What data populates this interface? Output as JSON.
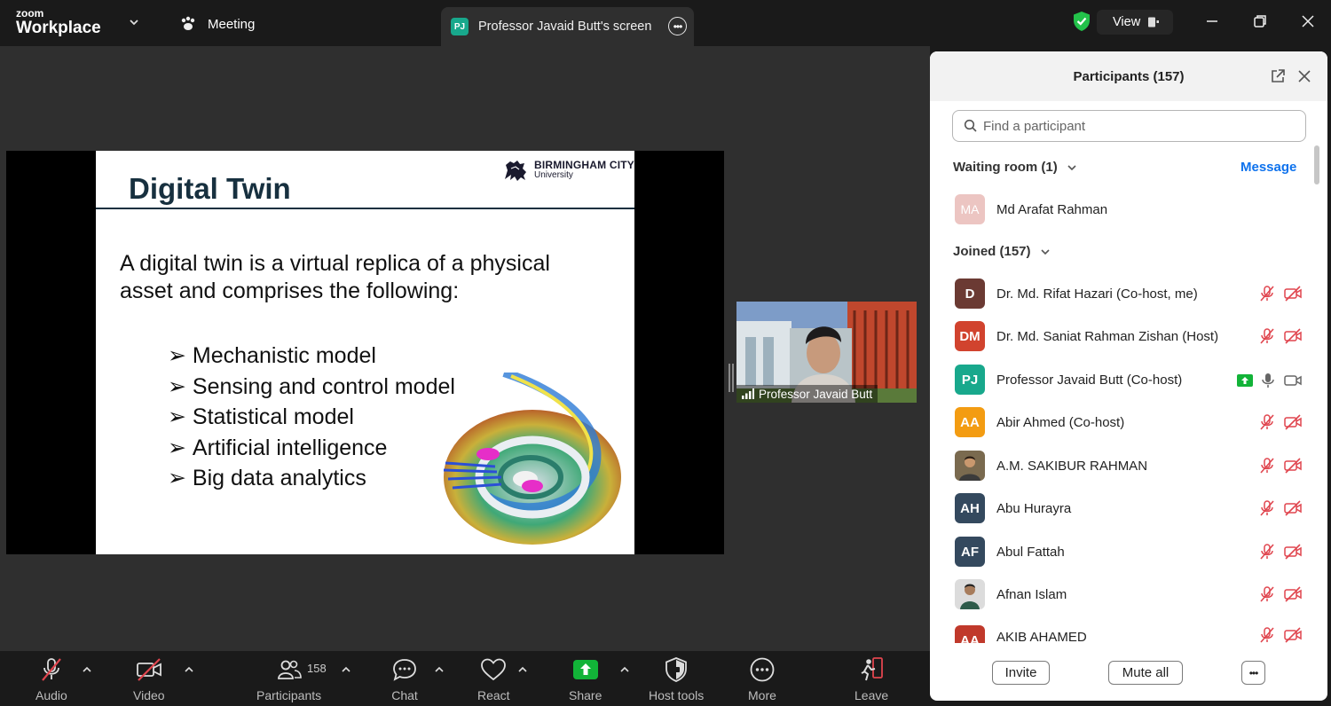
{
  "app": {
    "logo_top": "zoom",
    "logo_bottom": "Workplace"
  },
  "topbar": {
    "meeting_label": "Meeting",
    "screen_tab": {
      "initials": "PJ",
      "label": "Professor Javaid Butt's screen"
    },
    "view_label": "View"
  },
  "slide": {
    "title": "Digital Twin",
    "logo_line1": "BIRMINGHAM CITY",
    "logo_line2": "University",
    "intro": "A digital twin is a virtual replica of a physical asset and comprises the following:",
    "bullets": [
      "Mechanistic model",
      "Sensing and control model",
      "Statistical model",
      "Artificial intelligence",
      "Big data analytics"
    ]
  },
  "video_tile": {
    "name": "Professor Javaid Butt"
  },
  "participants_panel": {
    "title": "Participants (157)",
    "search_placeholder": "Find a participant",
    "waiting_room": {
      "label": "Waiting room (1)",
      "message_label": "Message"
    },
    "waiting": [
      {
        "initials": "MA",
        "name": "Md Arafat Rahman",
        "color": "#e9c8c8"
      }
    ],
    "joined_label": "Joined (157)",
    "joined": [
      {
        "initials": "D",
        "name": "Dr. Md. Rifat Hazari (Co-host, me)",
        "color": "#6b3a33",
        "muted": true,
        "video_off": true,
        "sharing": false
      },
      {
        "initials": "DM",
        "name": "Dr. Md. Saniat Rahman Zishan (Host)",
        "color": "#d1432e",
        "muted": true,
        "video_off": true,
        "sharing": false
      },
      {
        "initials": "PJ",
        "name": "Professor Javaid Butt (Co-host)",
        "color": "#18a88c",
        "muted": false,
        "video_off": false,
        "sharing": true
      },
      {
        "initials": "AA",
        "name": "Abir Ahmed (Co-host)",
        "color": "#f39c12",
        "muted": true,
        "video_off": true,
        "sharing": false
      },
      {
        "initials": "",
        "name": "A.M. SAKIBUR RAHMAN",
        "color": "#5c4a3a",
        "muted": true,
        "video_off": true,
        "sharing": false,
        "photo": true
      },
      {
        "initials": "AH",
        "name": "Abu Hurayra",
        "color": "#34495e",
        "muted": true,
        "video_off": true,
        "sharing": false
      },
      {
        "initials": "AF",
        "name": "Abul Fattah",
        "color": "#34495e",
        "muted": true,
        "video_off": true,
        "sharing": false
      },
      {
        "initials": "",
        "name": "Afnan Islam",
        "color": "#8b8f93",
        "muted": true,
        "video_off": true,
        "sharing": false,
        "photo": true
      },
      {
        "initials": "AA",
        "name": "AKIB AHAMED",
        "color": "#c0392b",
        "muted": true,
        "video_off": true,
        "sharing": false
      }
    ],
    "footer": {
      "invite": "Invite",
      "mute_all": "Mute all"
    }
  },
  "toolbar": {
    "audio": "Audio",
    "video": "Video",
    "participants": "Participants",
    "participants_count": "158",
    "chat": "Chat",
    "react": "React",
    "share": "Share",
    "host_tools": "Host tools",
    "more": "More",
    "leave": "Leave"
  },
  "colors": {
    "accent_blue": "#0e72ed",
    "share_green": "#12b338",
    "mute_red": "#e0454e"
  }
}
